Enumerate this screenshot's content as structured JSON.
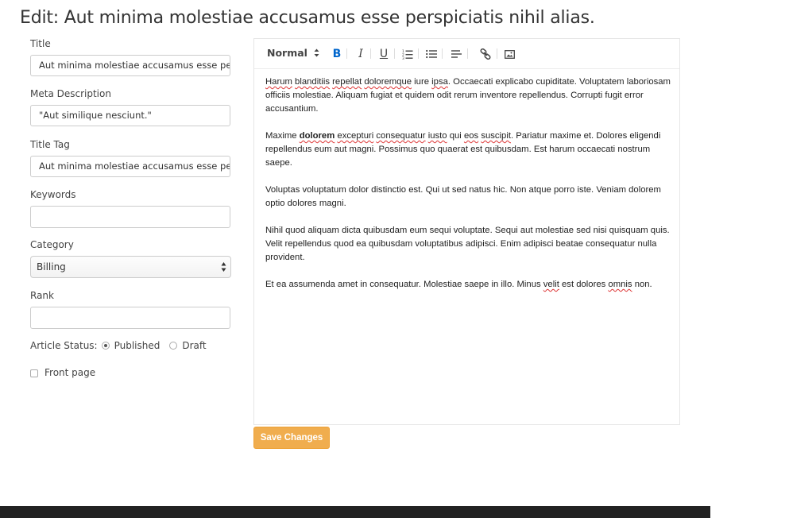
{
  "page": {
    "title": "Edit: Aut minima molestiae accusamus esse perspiciatis nihil alias."
  },
  "form": {
    "title_label": "Title",
    "title_value": "Aut minima molestiae accusamus esse perspiciatis nihil alias.",
    "meta_label": "Meta Description",
    "meta_value": "\"Aut similique nesciunt.\"",
    "title_tag_label": "Title Tag",
    "title_tag_value": "Aut minima molestiae accusamus esse perspiciatis nihil alias.",
    "keywords_label": "Keywords",
    "keywords_value": "",
    "category_label": "Category",
    "category_value": "Billing",
    "rank_label": "Rank",
    "rank_value": "",
    "status_label": "Article Status:",
    "status_published": "Published",
    "status_draft": "Draft",
    "status_selected": "Published",
    "front_page_label": "Front page",
    "front_page_checked": false
  },
  "editor": {
    "format_label": "Normal",
    "toolbar_icons": [
      "bold-icon",
      "italic-icon",
      "underline-icon",
      "ordered-list-icon",
      "bullet-list-icon",
      "align-icon",
      "link-icon",
      "image-icon"
    ],
    "paragraphs": [
      {
        "s1": "Harum",
        "t1": " ",
        "s2": "blanditiis",
        "t2": " ",
        "s3": "repellat",
        "t3": " ",
        "s4": "doloremque",
        "t4": " iure ",
        "s5": "ipsa",
        "t5": ". Occaecati explicabo cupiditate. Voluptatem laboriosam officiis molestiae. Aliquam fugiat et quidem odit rerum inventore repellendus. Corrupti fugit error accusantium."
      },
      {
        "a": "Maxime ",
        "bold": "dolorem",
        "b": " ",
        "s1": "excepturi",
        "c": " ",
        "s2": "consequatur",
        "d": " ",
        "s3": "iusto",
        "e": " qui ",
        "s4": "eos",
        "f": " ",
        "s5": "suscipit",
        "g": ". Pariatur maxime et. Dolores eligendi repellendus eum aut magni. Possimus quo quaerat est quibusdam. Est harum occaecati nostrum saepe."
      },
      {
        "text": "Voluptas voluptatum dolor distinctio est. Qui ut sed natus hic. Non atque porro iste. Veniam dolorem optio dolores magni."
      },
      {
        "text": "Nihil quod aliquam dicta quibusdam eum sequi voluptate. Sequi aut molestiae sed nisi quisquam quis. Velit repellendus quod ea quibusdam voluptatibus adipisci. Enim adipisci beatae consequatur nulla provident."
      },
      {
        "a": "Et ea assumenda amet in consequatur. Molestiae saepe in illo. Minus ",
        "s1": "velit",
        "b": " est dolores ",
        "s2": "omnis",
        "c": " non."
      }
    ]
  },
  "actions": {
    "save_label": "Save Changes"
  },
  "colors": {
    "save_button": "#f0ad4e",
    "bold_active": "#06c",
    "footer": "#222222"
  }
}
